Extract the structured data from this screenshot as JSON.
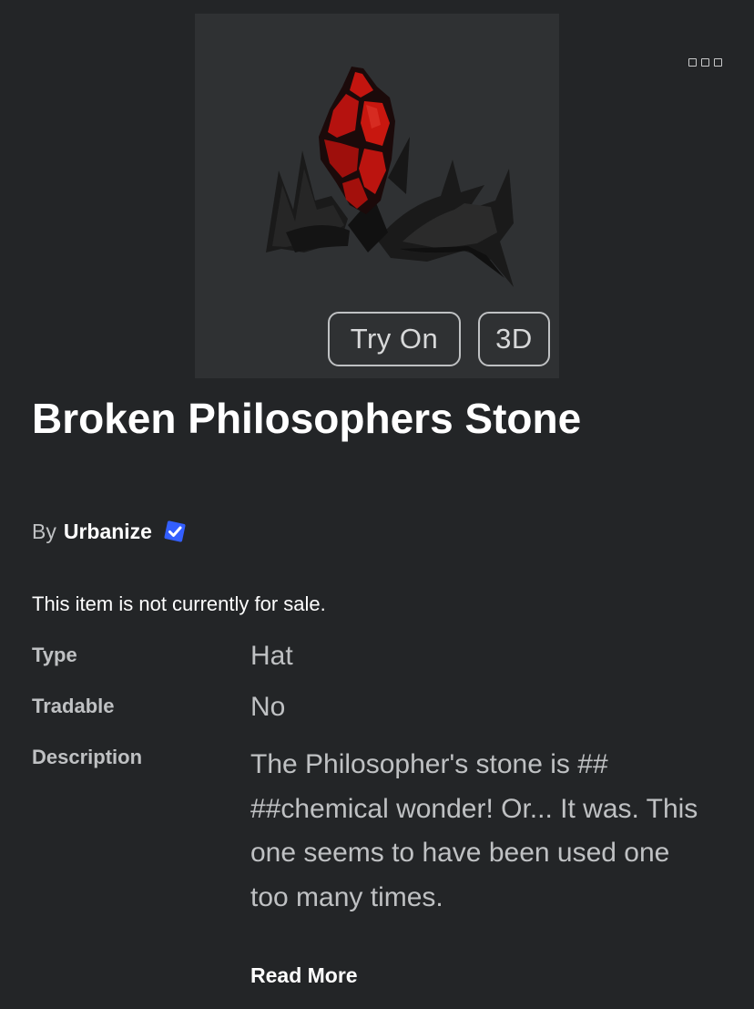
{
  "item": {
    "title": "Broken Philosophers Stone",
    "by_label": "By",
    "creator": "Urbanize",
    "sale_status": "This item is not currently for sale."
  },
  "thumbnail": {
    "try_on_label": "Try On",
    "view_3d_label": "3D"
  },
  "details": {
    "type_label": "Type",
    "type_value": "Hat",
    "tradable_label": "Tradable",
    "tradable_value": "No",
    "description_label": "Description",
    "description_value": "The Philosopher's stone is ## ##chemical wonder! Or... It was. This one seems to have been used one too many times.",
    "read_more_label": "Read More"
  },
  "icons": {
    "more": "more-options-icon",
    "verified": "verified-badge-icon"
  },
  "colors": {
    "background": "#232527",
    "thumbnail_bg": "#2f3133",
    "verified_blue": "#335fff",
    "gem_red": "#b5120f"
  }
}
